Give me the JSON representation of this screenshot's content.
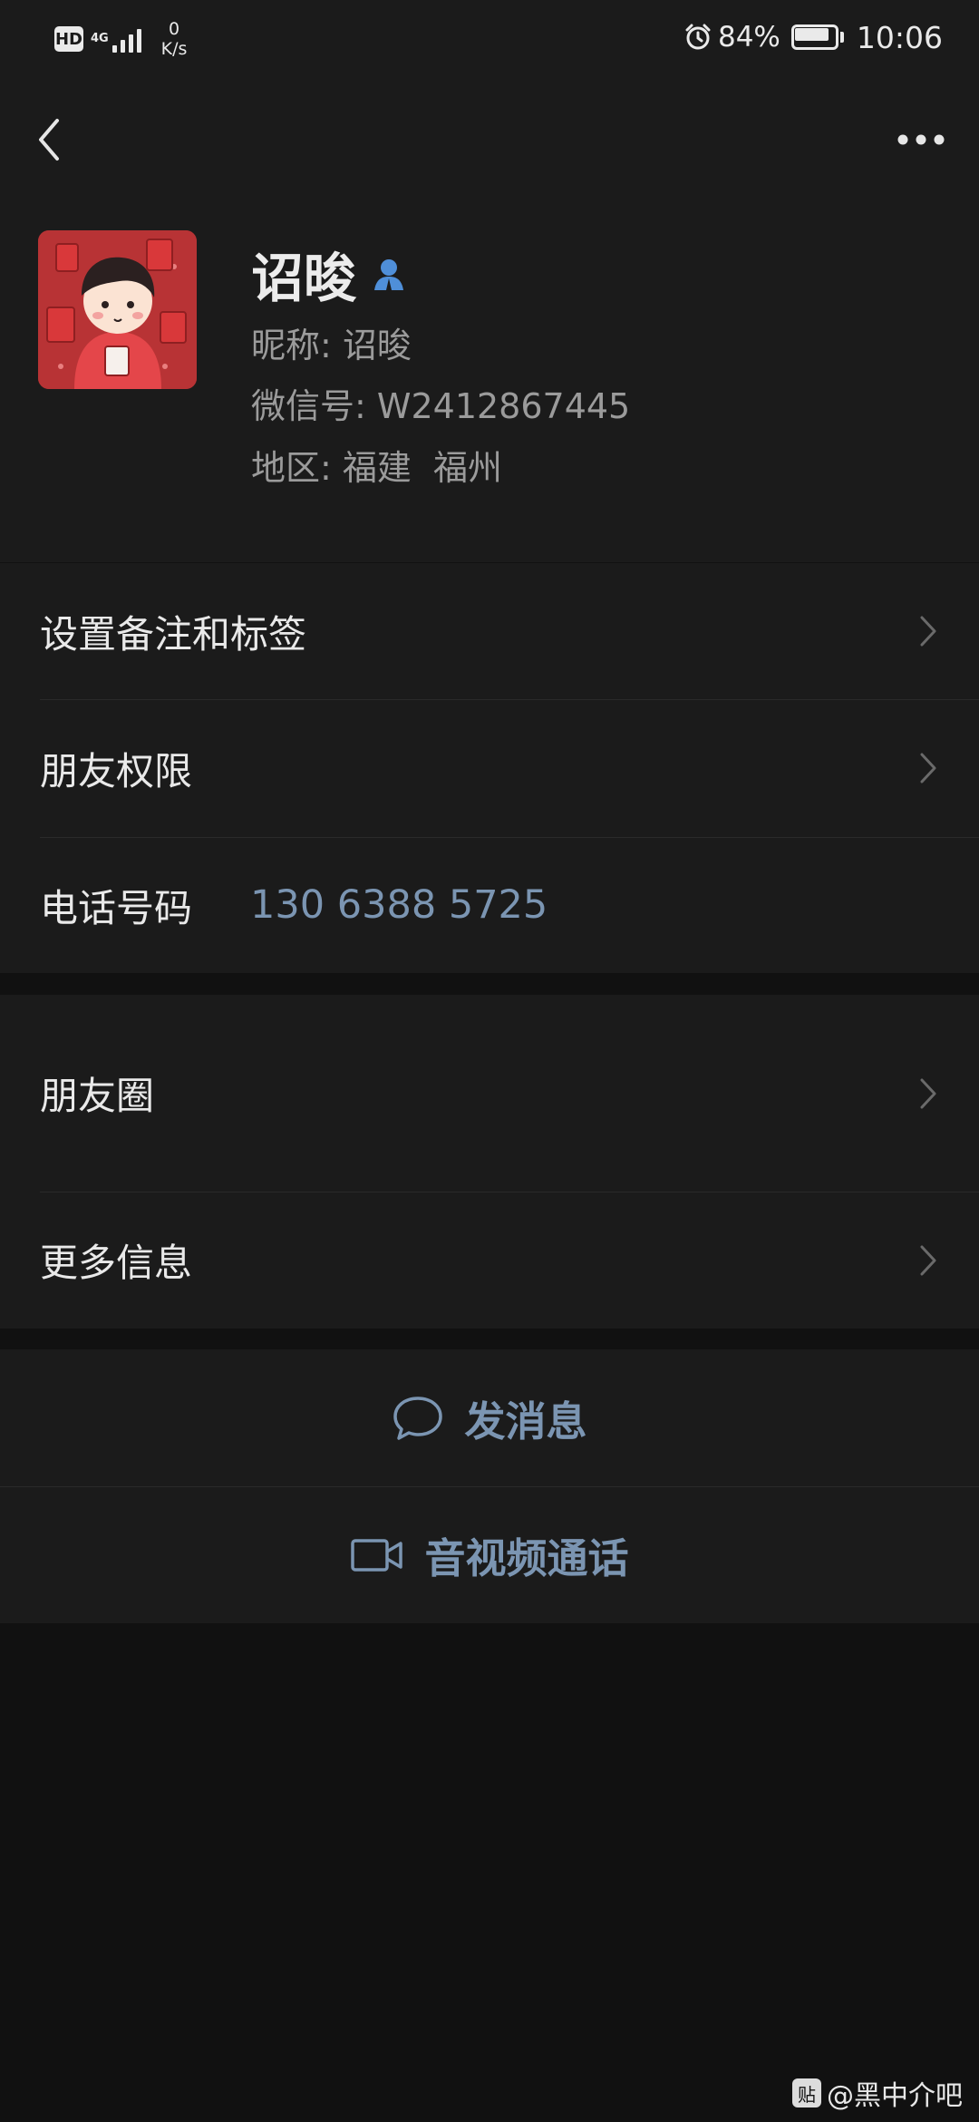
{
  "status_bar": {
    "hd": "HD",
    "network": "4G",
    "speed_value": "0",
    "speed_unit": "K/s",
    "battery": "84%",
    "battery_level": 0.84,
    "time": "10:06",
    "icons": [
      "alarm-icon",
      "battery-icon",
      "signal-icon"
    ]
  },
  "nav": {
    "back_icon": "chevron-left-icon",
    "more_icon": "more-dots-icon"
  },
  "profile": {
    "name": "诏晙",
    "nickname_label": "昵称: ",
    "nickname": "诏晙",
    "wechat_id_label": "微信号: ",
    "wechat_id": "W2412867445",
    "region_label": "地区: ",
    "region": "福建  福州",
    "contact_icon_color": "#4f8fd9"
  },
  "group1": {
    "remark_label": "设置备注和标签",
    "permission_label": "朋友权限",
    "phone_label": "电话号码",
    "phone_value": "130 6388 5725"
  },
  "group2": {
    "moments_label": "朋友圈",
    "more_info_label": "更多信息"
  },
  "actions": {
    "message_label": "发消息",
    "call_label": "音视频通话"
  },
  "watermark": {
    "badge": "贴",
    "text": "@黑中介吧"
  },
  "colors": {
    "background": "#111111",
    "panel": "#1b1b1b",
    "link": "#7b95b2"
  }
}
